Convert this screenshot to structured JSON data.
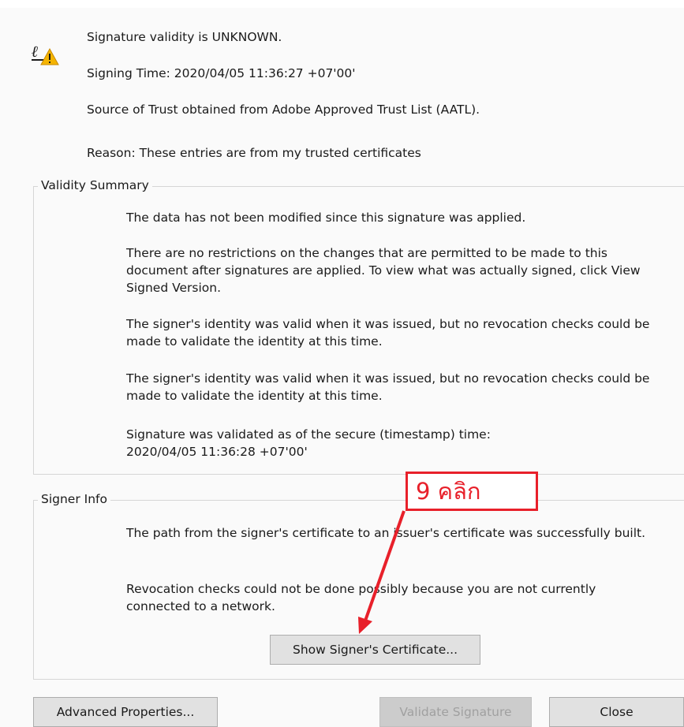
{
  "header": {
    "validity_status": "Signature validity is UNKNOWN.",
    "signing_time": "Signing Time:  2020/04/05 11:36:27 +07'00'",
    "trust_source": "Source of Trust obtained from Adobe Approved Trust List (AATL).",
    "reason": "Reason:  These entries are from my trusted certificates"
  },
  "validity_summary": {
    "legend": "Validity Summary",
    "items": [
      "The data has not been modified since this signature was applied.",
      "There are no restrictions on the changes that are permitted to be made to this document after signatures are applied. To view what was actually signed, click View Signed Version.",
      "The signer's identity was valid when it was issued, but no revocation checks could be made to validate the identity at this time.",
      "The signer's identity was valid when it was issued, but no revocation checks could be made to validate the identity at this time.",
      "Signature was validated as of the secure (timestamp) time: 2020/04/05 11:36:28 +07'00'"
    ]
  },
  "signer_info": {
    "legend": "Signer Info",
    "items": [
      "The path from the signer's certificate to an issuer's certificate was successfully built.",
      "Revocation checks could not be done possibly because you are not currently connected to a network."
    ],
    "show_certificate_label": "Show Signer's Certificate..."
  },
  "footer": {
    "advanced_properties_label": "Advanced Properties...",
    "validate_signature_label": "Validate Signature",
    "close_label": "Close"
  },
  "annotation": {
    "label": "9 คลิก",
    "color": "#e8202a"
  },
  "icons": {
    "signature": "signature-warning-icon"
  }
}
